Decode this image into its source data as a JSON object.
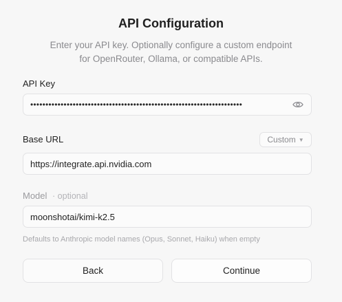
{
  "header": {
    "title": "API Configuration",
    "subtitle_line1": "Enter your API key. Optionally configure a custom endpoint",
    "subtitle_line2": "for OpenRouter, Ollama, or compatible APIs."
  },
  "api_key": {
    "label": "API Key",
    "masked_value": "••••••••••••••••••••••••••••••••••••••••••••••••••••••••••••••••••••••",
    "toggle_icon": "eye-icon"
  },
  "base_url": {
    "label": "Base URL",
    "preset_selected": "Custom",
    "value": "https://integrate.api.nvidia.com"
  },
  "model": {
    "label": "Model",
    "optional_tag": "· optional",
    "value": "moonshotai/kimi-k2.5",
    "hint": "Defaults to Anthropic model names (Opus, Sonnet, Haiku) when empty"
  },
  "actions": {
    "back_label": "Back",
    "continue_label": "Continue"
  }
}
